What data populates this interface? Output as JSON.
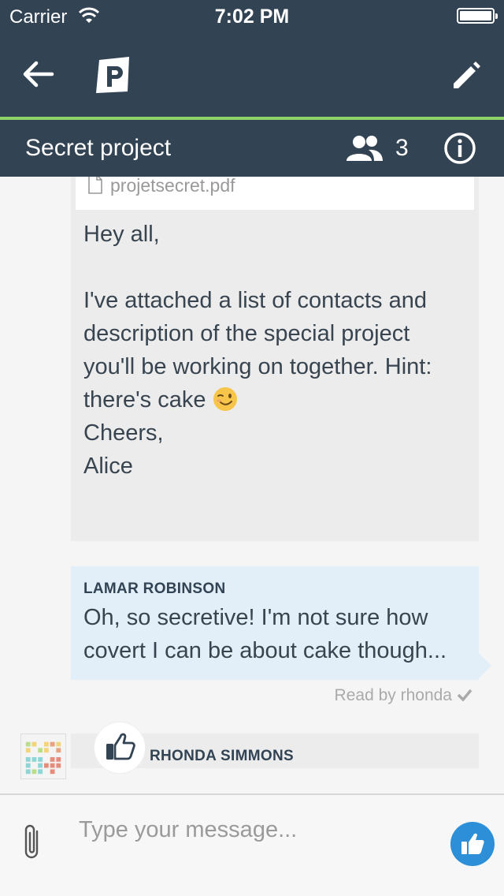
{
  "status_bar": {
    "carrier": "Carrier",
    "time": "7:02 PM"
  },
  "header": {
    "conversation_title": "Secret project",
    "participants_count": "3"
  },
  "colors": {
    "nav_bg": "#324354",
    "accent": "#8fd16b",
    "bubble_blue": "#e2eef8",
    "like_blue": "#2d8fd8"
  },
  "messages": [
    {
      "attachment": {
        "filename": "projetsecret.pdf",
        "icon": "file-icon"
      },
      "body": "Hey all,\n\nI've attached a list of contacts and description of the special project you'll be working on together. Hint: there's cake ",
      "emoji": "winking-face-emoji",
      "closing": "\nCheers,\nAlice"
    },
    {
      "sender": "LAMAR ROBINSON",
      "text": "Oh, so secretive! I'm not sure how covert I can be about cake though...",
      "read_receipt": "Read by rhonda"
    },
    {
      "sender": "RHONDA SIMMONS",
      "reaction": "thumbs-up-icon"
    }
  ],
  "composer": {
    "placeholder": "Type your message..."
  }
}
